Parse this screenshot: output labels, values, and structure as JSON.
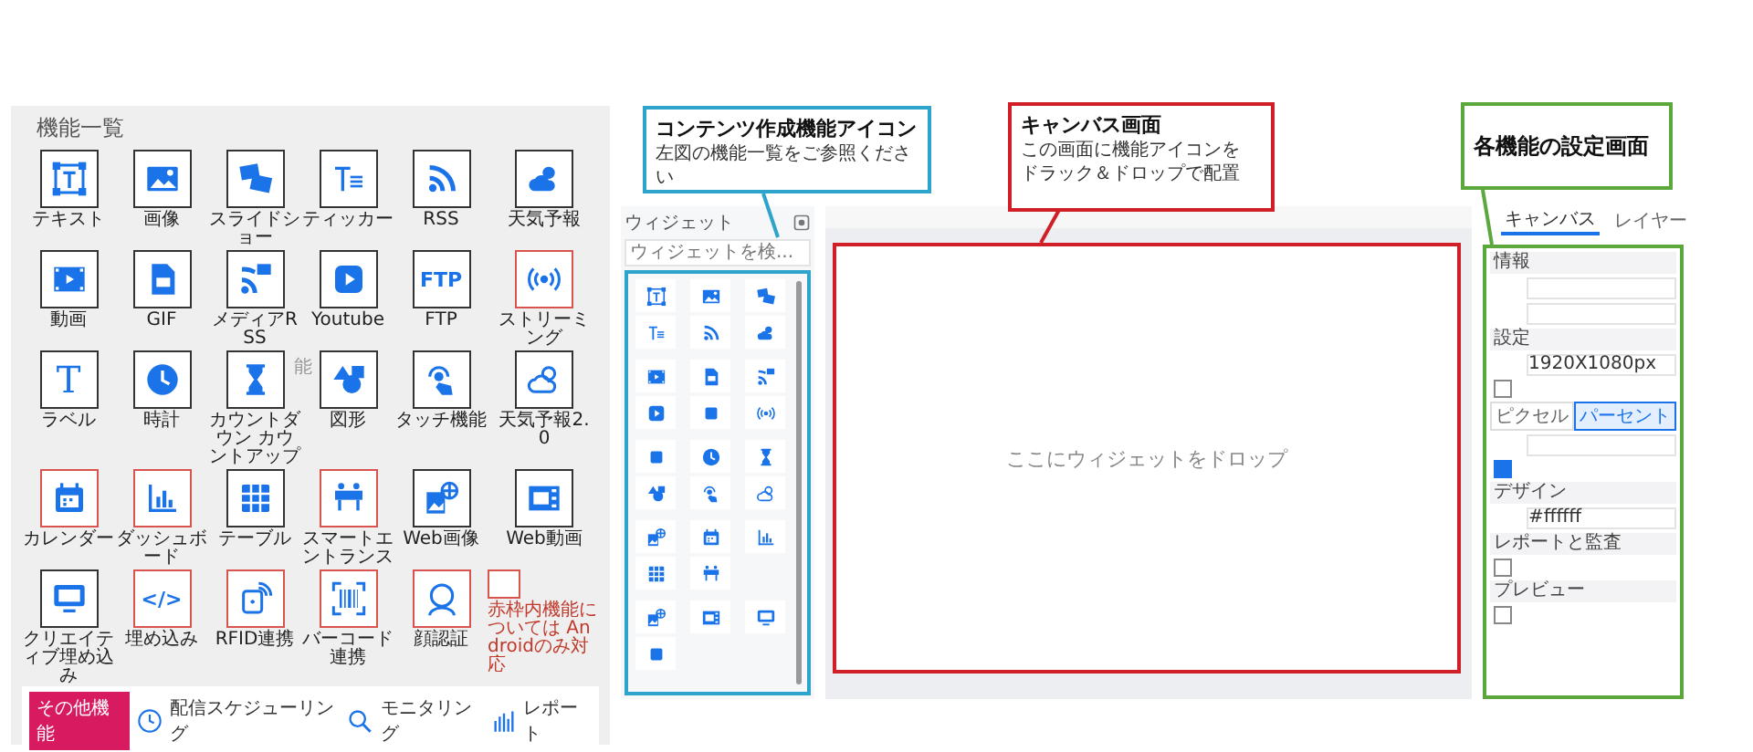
{
  "catalog": {
    "title": "機能一覧",
    "tiles": [
      {
        "label": "テキスト",
        "android_only": false
      },
      {
        "label": "画像",
        "android_only": false
      },
      {
        "label": "スライドショー",
        "android_only": false
      },
      {
        "label": "ティッカー",
        "android_only": false
      },
      {
        "label": "RSS",
        "android_only": false
      },
      {
        "label": "天気予報",
        "android_only": false
      },
      {
        "label": "動画",
        "android_only": false
      },
      {
        "label": "GIF",
        "android_only": false
      },
      {
        "label": "メディアRSS",
        "android_only": false
      },
      {
        "label": "Youtube",
        "android_only": false
      },
      {
        "label": "FTP",
        "android_only": false,
        "glyph": "FTP"
      },
      {
        "label": "ストリーミング",
        "android_only": true
      },
      {
        "label": "ラベル",
        "android_only": false,
        "glyph": "T"
      },
      {
        "label": "時計",
        "android_only": false
      },
      {
        "label": "カウントダウン カウントアップ",
        "android_only": false
      },
      {
        "label": "図形",
        "android_only": false
      },
      {
        "label": "タッチ機能",
        "android_only": false
      },
      {
        "label": "天気予報2.0",
        "android_only": false
      },
      {
        "label": "カレンダー",
        "android_only": true
      },
      {
        "label": "ダッシュボード",
        "android_only": true
      },
      {
        "label": "テーブル",
        "android_only": false
      },
      {
        "label": "スマートエントランス",
        "android_only": true
      },
      {
        "label": "Web画像",
        "android_only": false
      },
      {
        "label": "Web動画",
        "android_only": false
      },
      {
        "label": "クリエイティブ埋め込み",
        "android_only": false
      },
      {
        "label": "埋め込み",
        "android_only": true,
        "glyph": "</>"
      },
      {
        "label": "RFID連携",
        "android_only": true
      },
      {
        "label": "バーコード連携",
        "android_only": true
      },
      {
        "label": "顔認証",
        "android_only": true
      }
    ],
    "note": "赤枠内機能については Androidのみ対応",
    "stray_text": "能"
  },
  "other_features": {
    "badge": "その他機能",
    "items": [
      "配信スケジューリング",
      "モニタリング",
      "レポート"
    ]
  },
  "widget_panel": {
    "title": "ウィジェット",
    "search": {
      "placeholder": "ウィジェットを検..."
    }
  },
  "canvas": {
    "drop_hint": "ここにウィジェットをドロップ"
  },
  "settings": {
    "tabs": [
      {
        "label": "キャンバス",
        "selected": true
      },
      {
        "label": "レイヤー",
        "selected": false
      }
    ],
    "sections": [
      {
        "title": "情報",
        "fields": [
          {
            "kind": "input"
          },
          {
            "kind": "input"
          }
        ]
      },
      {
        "title": "設定",
        "fields": [
          {
            "kind": "value",
            "value": "1920X1080px"
          },
          {
            "kind": "checkbox",
            "checked": false
          },
          {
            "kind": "segments",
            "options": [
              {
                "label": "ピクセル",
                "selected": false
              },
              {
                "label": "パーセント",
                "selected": true
              }
            ]
          },
          {
            "kind": "input"
          },
          {
            "kind": "checkbox",
            "checked": true
          }
        ]
      },
      {
        "title": "デザイン",
        "fields": [
          {
            "kind": "value",
            "value": "#ffffff"
          }
        ]
      },
      {
        "title": "レポートと監査",
        "fields": [
          {
            "kind": "checkbox",
            "checked": false
          }
        ]
      },
      {
        "title": "プレビュー",
        "fields": [
          {
            "kind": "checkbox",
            "checked": false
          }
        ]
      }
    ]
  },
  "callouts": [
    {
      "title": "コンテンツ作成機能アイコン",
      "lines": [
        "左図の機能一覧をご参照ください"
      ],
      "color": "#2ea3cc"
    },
    {
      "title": "キャンバス画面",
      "lines": [
        "この画面に機能アイコンを",
        "ドラック＆ドロップで配置"
      ],
      "color": "#d01f26"
    },
    {
      "title": "各機能の設定画面",
      "color": "#5aa83c"
    }
  ]
}
